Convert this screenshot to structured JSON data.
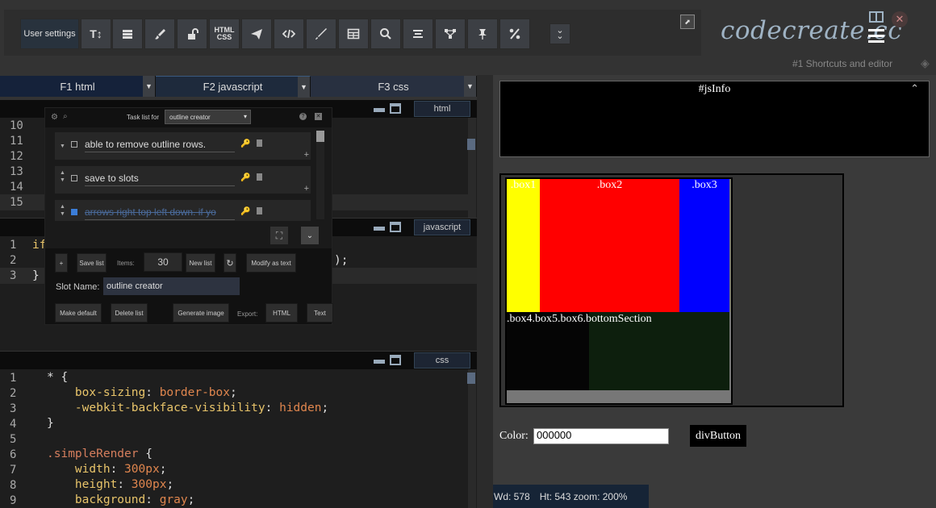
{
  "toolbar": {
    "settings_label": "User settings",
    "html_css_label": "HTML\nCSS",
    "icons": [
      "text-size-icon",
      "layers-icon",
      "brush-icon",
      "unlock-icon",
      "html-css-icon",
      "send-icon",
      "code-icon",
      "pen-icon",
      "table-icon",
      "search-icon",
      "align-icon",
      "nodes-icon",
      "pin-icon",
      "percent-icon",
      "collapse-icon"
    ]
  },
  "brand": {
    "logo": "codecreate.cc",
    "shortcuts_link": "#1 Shortcuts and editor"
  },
  "tabs": [
    {
      "label": "F1 html"
    },
    {
      "label": "F2 javascript"
    },
    {
      "label": "F3 css"
    }
  ],
  "html_editor": {
    "label": "html",
    "lines": [
      "10",
      "11",
      "12",
      "13",
      "14",
      "15"
    ]
  },
  "js_editor": {
    "label": "javascript",
    "lines": [
      "1",
      "2",
      "3"
    ],
    "code": [
      "if",
      "",
      "}"
    ],
    "tail": ");"
  },
  "css_editor": {
    "label": "css",
    "lines": [
      "1",
      "2",
      "3",
      "4",
      "5",
      "6",
      "7",
      "8",
      "9"
    ],
    "code": [
      {
        "parts": [
          [
            "brace",
            "* {"
          ]
        ]
      },
      {
        "parts": [
          [
            "kw",
            "    box-sizing"
          ],
          [
            "brace",
            ": "
          ],
          [
            "val",
            "border-box"
          ],
          [
            "brace",
            ";"
          ]
        ]
      },
      {
        "parts": [
          [
            "kw",
            "    -webkit-backface-visibility"
          ],
          [
            "brace",
            ": "
          ],
          [
            "val",
            "hidden"
          ],
          [
            "brace",
            ";"
          ]
        ]
      },
      {
        "parts": [
          [
            "brace",
            "}"
          ]
        ]
      },
      {
        "parts": []
      },
      {
        "parts": [
          [
            "sel",
            ".simpleRender"
          ],
          [
            "brace",
            " {"
          ]
        ]
      },
      {
        "parts": [
          [
            "kw",
            "    width"
          ],
          [
            "brace",
            ": "
          ],
          [
            "num",
            "300px"
          ],
          [
            "brace",
            ";"
          ]
        ]
      },
      {
        "parts": [
          [
            "kw",
            "    height"
          ],
          [
            "brace",
            ": "
          ],
          [
            "num",
            "300px"
          ],
          [
            "brace",
            ";"
          ]
        ]
      },
      {
        "parts": [
          [
            "kw",
            "    background"
          ],
          [
            "brace",
            ": "
          ],
          [
            "val",
            "gray"
          ],
          [
            "brace",
            ";"
          ]
        ]
      }
    ]
  },
  "tasklist": {
    "title": "Task list for",
    "selected_list": "outline creator",
    "items": [
      {
        "text": "able to remove outline rows.",
        "checked": false
      },
      {
        "text": "save to slots",
        "checked": false
      },
      {
        "text": "arrows right top left down. if yo",
        "checked": true
      }
    ],
    "add_label": "+",
    "save_label": "Save list",
    "items_label": "Items:",
    "items_count": "30",
    "new_label": "New list",
    "refresh_label": "↻",
    "modify_label": "Modify as text",
    "slot_label": "Slot Name:",
    "slot_value": "outline creator",
    "make_default_label": "Make default",
    "delete_label": "Delete list",
    "generate_label": "Generate image",
    "export_label": "Export:",
    "html_label": "HTML",
    "text_label": "Text"
  },
  "preview": {
    "jsinfo_title": "#jsInfo",
    "box1": ".box1",
    "box2": ".box2",
    "box3": ".box3",
    "box456": ".box4.box5.box6.bottomSection",
    "color_label": "Color:",
    "color_value": "000000",
    "div_button": "divButton",
    "status_wd": "Wd: 578",
    "status_ht": "Ht: 543 zoom: 200%"
  },
  "colors": {
    "box1": "#ffff00",
    "box2": "#ff0000",
    "box3": "#0000ff",
    "bottom_dark": "#050505",
    "bottom_green": "#0d1f0d"
  }
}
